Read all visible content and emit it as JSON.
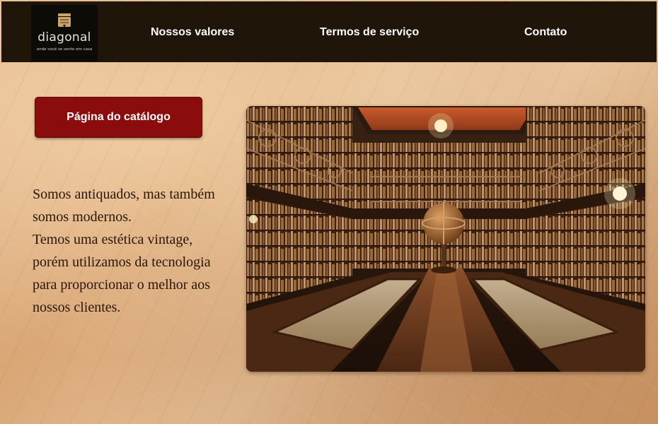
{
  "brand": {
    "name": "diagonal",
    "tagline": "onde você se sente em casa",
    "logo_icon": "book-icon"
  },
  "nav": {
    "items": [
      {
        "label": "Nossos valores"
      },
      {
        "label": "Termos de serviço"
      },
      {
        "label": "Contato"
      }
    ]
  },
  "main": {
    "catalog_button_label": "Página do  catálogo",
    "tagline_text": "Somos antiquados, mas também\nsomos modernos.\nTemos uma estética vintage,\nporém utilizamos da tecnologia\npara proporcionar o melhor aos\nnossos clientes.",
    "hero_image": "library-interior-photo"
  },
  "colors": {
    "topbar": "#1f1609",
    "logo_bg": "#0d0b08",
    "button": "#8b0c0c",
    "text_dark": "#2a1508",
    "paper": "#dcae82"
  }
}
